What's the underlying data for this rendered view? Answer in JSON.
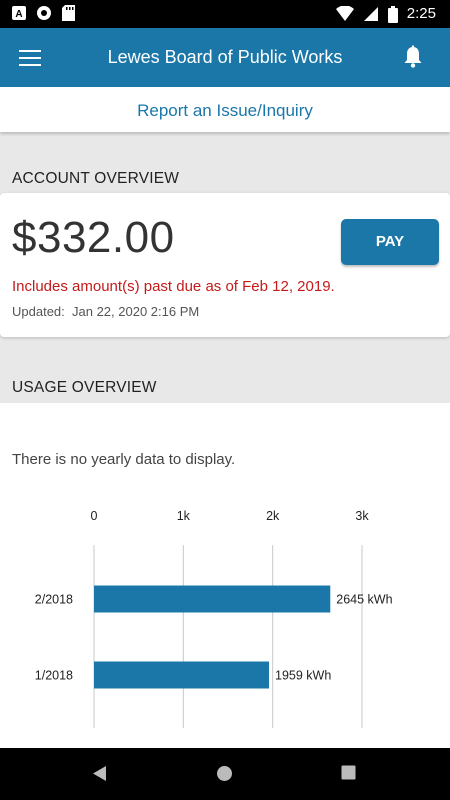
{
  "status_bar": {
    "time": "2:25",
    "icons": [
      "a-notification-icon",
      "circle-notification-icon",
      "sd-card-icon",
      "wifi-icon",
      "cellular-signal-icon",
      "battery-icon"
    ]
  },
  "header": {
    "title": "Lewes Board of Public Works",
    "menu_icon": "hamburger-menu-icon",
    "notifications_icon": "bell-icon",
    "color": "#1b77a8"
  },
  "report_link": "Report an Issue/Inquiry",
  "account": {
    "section_title": "ACCOUNT OVERVIEW",
    "amount": "$332.00",
    "pay_label": "PAY",
    "past_due": "Includes amount(s) past due as of Feb 12, 2019.",
    "updated_label": "Updated:",
    "updated_value": "Jan 22, 2020 2:16 PM",
    "past_due_color": "#c41a1a"
  },
  "usage": {
    "section_title": "USAGE OVERVIEW",
    "no_data": "There is no yearly data to display."
  },
  "chart_data": {
    "type": "bar",
    "orientation": "horizontal",
    "categories": [
      "2/2018",
      "1/2018"
    ],
    "values": [
      2645,
      1959
    ],
    "value_labels": [
      "2645 kWh",
      "1959 kWh"
    ],
    "xlim": [
      0,
      3000
    ],
    "ticks": [
      0,
      1000,
      2000,
      3000
    ],
    "tick_labels": [
      "0",
      "1k",
      "2k",
      "3k"
    ],
    "grid": true,
    "bar_color": "#1b77a8"
  },
  "nav_bar": {
    "icons": [
      "back-triangle-icon",
      "home-circle-icon",
      "recents-square-icon"
    ]
  }
}
